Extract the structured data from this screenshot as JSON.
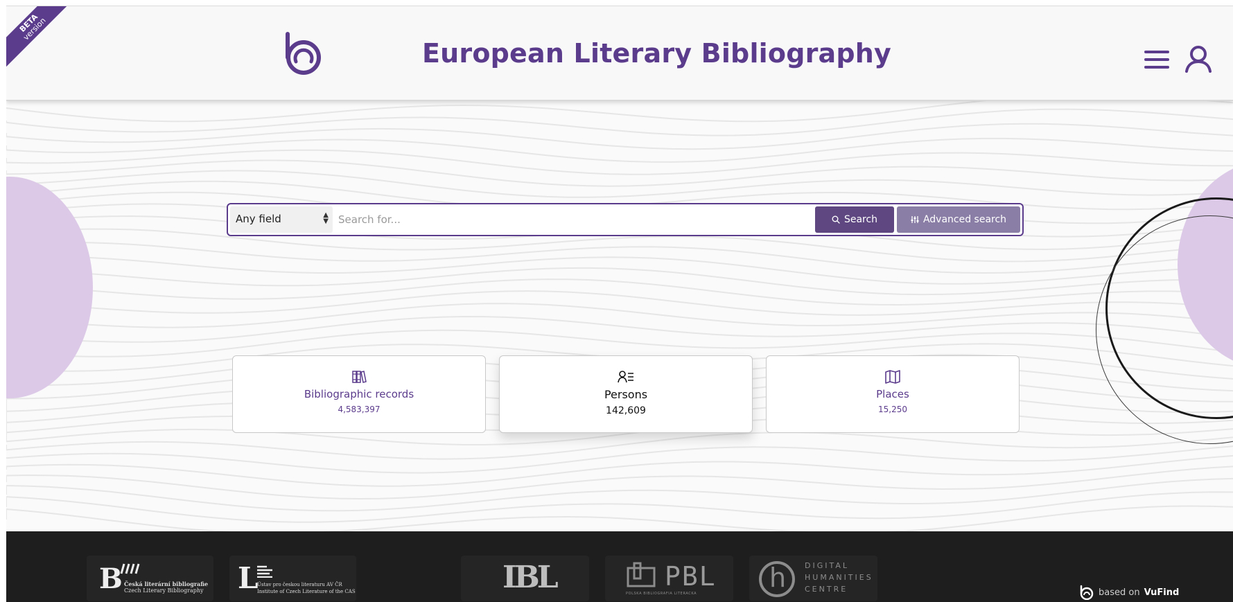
{
  "header": {
    "beta_label": "BETA",
    "version_label": "version",
    "title": "European Literary Bibliography"
  },
  "search": {
    "field_selected": "Any field",
    "placeholder": "Search for...",
    "search_button": "Search",
    "advanced_button": "Advanced search"
  },
  "cards": [
    {
      "label": "Bibliographic records",
      "count": "4,583,397",
      "icon": "books-icon"
    },
    {
      "label": "Persons",
      "count": "142,609",
      "icon": "persons-list-icon"
    },
    {
      "label": "Places",
      "count": "15,250",
      "icon": "map-icon"
    }
  ],
  "footer": {
    "logo1_big": "B",
    "logo1_line1": "Česká literární bibliografie",
    "logo1_line2": "Czech Literary Bibliography",
    "logo2_big": "L",
    "logo2_line1": "Ústav pro českou literaturu AV ČR",
    "logo2_line2": "Institute of Czech Literature of the CAS",
    "logo3_text": "IBL",
    "logo4_text": "PBL",
    "logo4_sub": "POLSKA BIBLIOGRAFIA LITERACKA",
    "logo5_letter": "h",
    "logo5_line1": "DIGITAL",
    "logo5_line2": "HUMANITIES",
    "logo5_line3": "CENTRE",
    "based_on": "based on",
    "vufind": "VuFind"
  },
  "colors": {
    "brand": "#5b3b8c",
    "search_button": "#5f4882",
    "advanced_button": "#8a7ea6",
    "lavender": "#dcc9e7",
    "footer_bg": "#1e1e1e"
  }
}
